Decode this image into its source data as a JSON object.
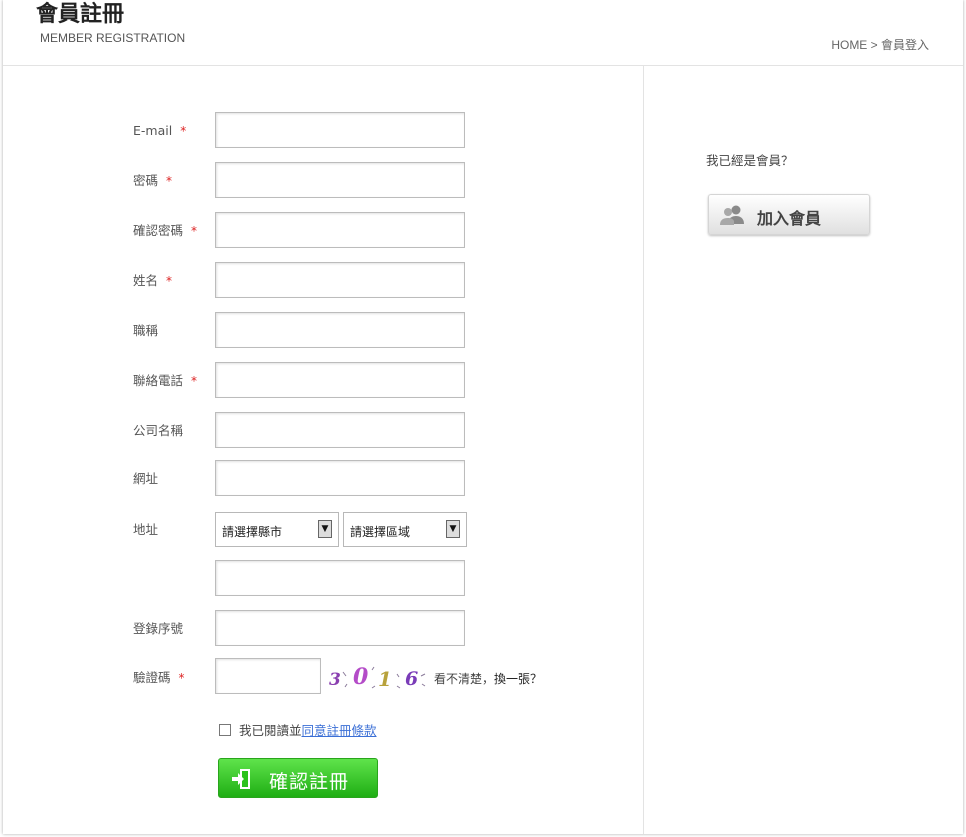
{
  "header": {
    "title": "會員註冊",
    "subtitle": "MEMBER REGISTRATION",
    "breadcrumb": "HOME > 會員登入"
  },
  "form": {
    "required_mark": "*",
    "email_label": "E-mail",
    "password_label": "密碼",
    "confirm_password_label": "確認密碼",
    "name_label": "姓名",
    "job_title_label": "職稱",
    "phone_label": "聯絡電話",
    "company_label": "公司名稱",
    "website_label": "網址",
    "address_label": "地址",
    "city_select": "請選擇縣市",
    "district_select": "請選擇區域",
    "serial_label": "登錄序號",
    "captcha_label": "驗證碼",
    "captcha_code": [
      "3",
      "0",
      "1",
      "6"
    ],
    "captcha_hint": "看不清楚，",
    "captcha_refresh": "換一張？",
    "agree_text": "我已閱讀並",
    "terms_link": "同意註冊條款",
    "submit_label": "確認註冊"
  },
  "sidebar": {
    "already_member_text": "我已經是會員？",
    "join_button_label": "加入會員"
  }
}
